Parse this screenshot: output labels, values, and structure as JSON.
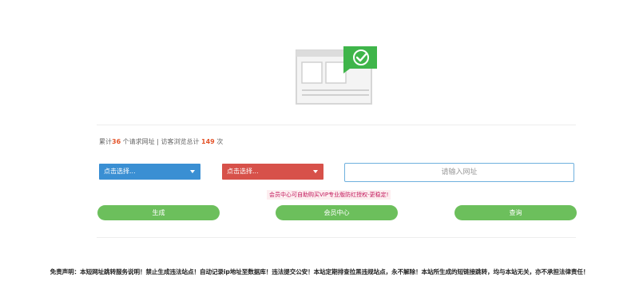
{
  "hero": {
    "icon": "browser-window-checkmark-icon",
    "accent_color": "#3fb54a"
  },
  "stats": {
    "prefix": "累计",
    "request_count": "36",
    "request_label": " 个请求网址 | 访客浏览总计 ",
    "visit_count": "149",
    "suffix": " 次"
  },
  "form": {
    "select_left": {
      "value": "点击选择...",
      "color": "#3a8fd3"
    },
    "select_right": {
      "value": "点击选择...",
      "color": "#d7514a"
    },
    "url_input": {
      "placeholder": "请输入网址",
      "value": ""
    },
    "promo_notice": "会员中心可自助购买VIP专业版防红授权-更稳定!"
  },
  "buttons": {
    "generate": "生成",
    "member_center": "会员中心",
    "query": "查询",
    "color": "#6cbf5c"
  },
  "footer": {
    "disclaimer": "免责声明：本短网址跳转服务说明！禁止生成违法站点！自动记录ip地址至数据库！违法提交公安！本站定期排查拉黑违规站点，永不解除！本站所生成的短链接跳转，均与本站无关，亦不承担法律责任！"
  }
}
